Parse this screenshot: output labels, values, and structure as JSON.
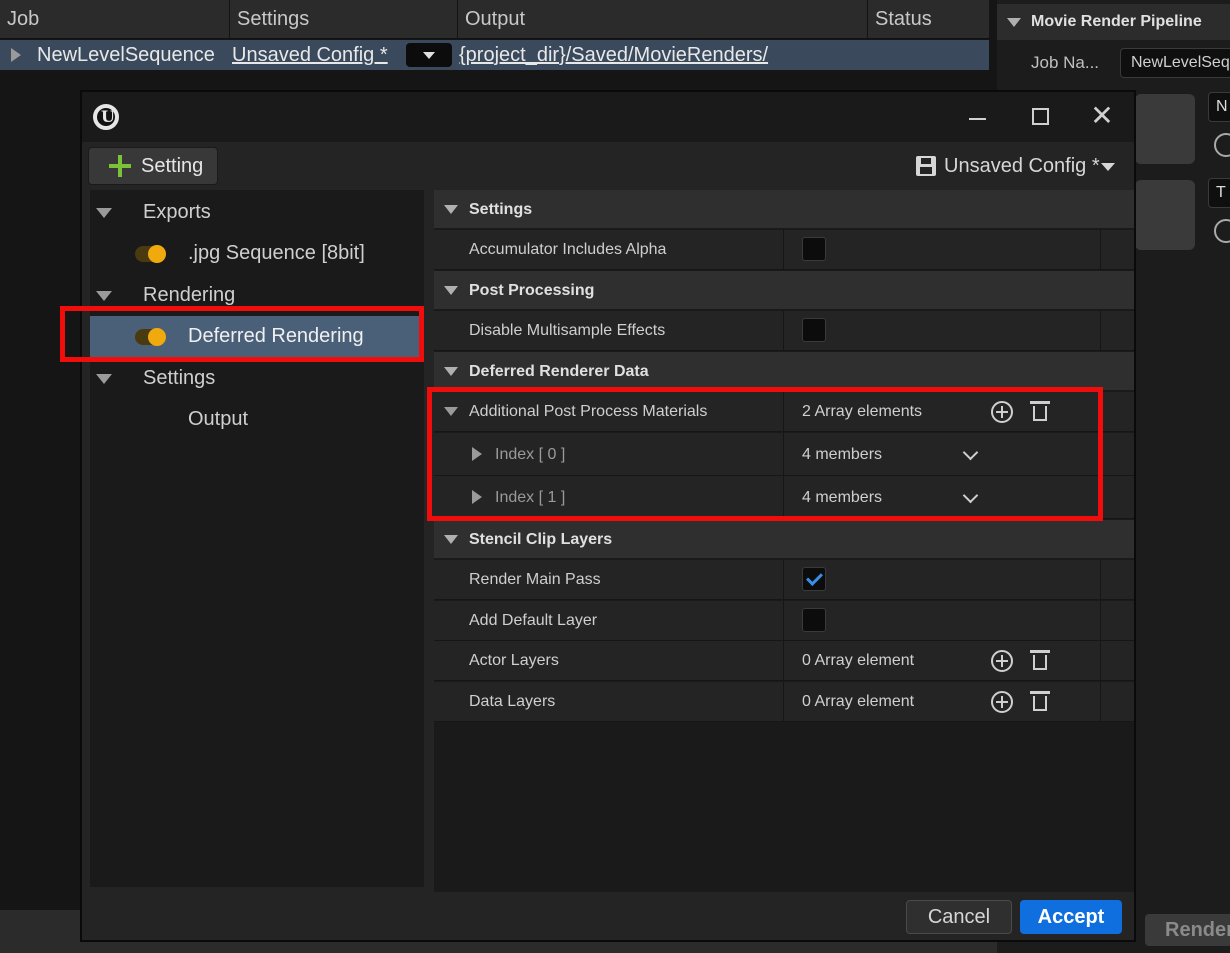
{
  "job_list": {
    "columns": [
      "Job",
      "Settings",
      "Output",
      "Status"
    ],
    "row": {
      "job": "NewLevelSequence",
      "settings": "Unsaved Config *",
      "output": "{project_dir}/Saved/MovieRenders/"
    }
  },
  "side_panel": {
    "title": "Movie Render Pipeline",
    "job_name_label": "Job Na...",
    "job_name_value": "NewLevelSequ",
    "thumb_letters": [
      "N",
      "T"
    ],
    "render_button": "Render"
  },
  "dialog": {
    "add_setting": "Setting",
    "config_name": "Unsaved Config *",
    "tree": [
      {
        "label": "Exports",
        "type": "category"
      },
      {
        "label": ".jpg Sequence [8bit]",
        "type": "setting",
        "enabled": true
      },
      {
        "label": "Rendering",
        "type": "category"
      },
      {
        "label": "Deferred Rendering",
        "type": "setting",
        "enabled": true,
        "selected": true
      },
      {
        "label": "Settings",
        "type": "category"
      },
      {
        "label": "Output",
        "type": "setting",
        "enabled": false
      }
    ],
    "details": {
      "cat_settings": "Settings",
      "accumulator_alpha": "Accumulator Includes Alpha",
      "cat_post": "Post Processing",
      "disable_msaa": "Disable Multisample Effects",
      "cat_deferred": "Deferred Renderer Data",
      "additional_ppm": "Additional Post Process Materials",
      "additional_ppm_value": "2 Array elements",
      "index0": "Index [ 0 ]",
      "index0_value": "4 members",
      "index1": "Index [ 1 ]",
      "index1_value": "4 members",
      "cat_stencil": "Stencil Clip Layers",
      "render_main_pass": "Render Main Pass",
      "add_default_layer": "Add Default Layer",
      "actor_layers": "Actor Layers",
      "actor_layers_value": "0 Array element",
      "data_layers": "Data Layers",
      "data_layers_value": "0 Array element"
    },
    "cancel": "Cancel",
    "accept": "Accept"
  },
  "colors": {
    "accent": "#0f6fde",
    "toggle": "#f0aa0e",
    "highlight": "#f20d0d",
    "selected_row": "#4a5f78"
  }
}
